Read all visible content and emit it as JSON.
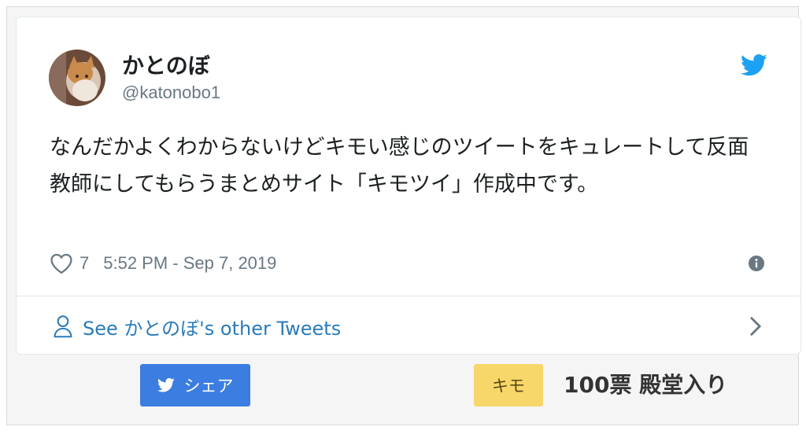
{
  "tweet": {
    "author_name": "かとのぼ",
    "author_handle": "@katonobo1",
    "text": "なんだかよくわからないけどキモい感じのツイートをキュレートして反面教師にしてもらうまとめサイト「キモツイ」作成中です。",
    "likes": "7",
    "timestamp": "5:52 PM - Sep 7, 2019",
    "see_more": "See かとのぼ's other Tweets",
    "icons": {
      "brand": "twitter-bird-icon",
      "like": "heart-icon",
      "info": "info-icon",
      "person": "person-icon",
      "chevron": "chevron-right-icon"
    }
  },
  "footer": {
    "share_label": "シェア",
    "kimo_label": "キモ",
    "votes_text": "100票 殿堂入り"
  },
  "colors": {
    "link": "#2b7bb9",
    "twitter_blue": "#1da1f2",
    "share_button": "#3b7de0",
    "kimo_button": "#f8d76a",
    "muted_text": "#697882"
  }
}
